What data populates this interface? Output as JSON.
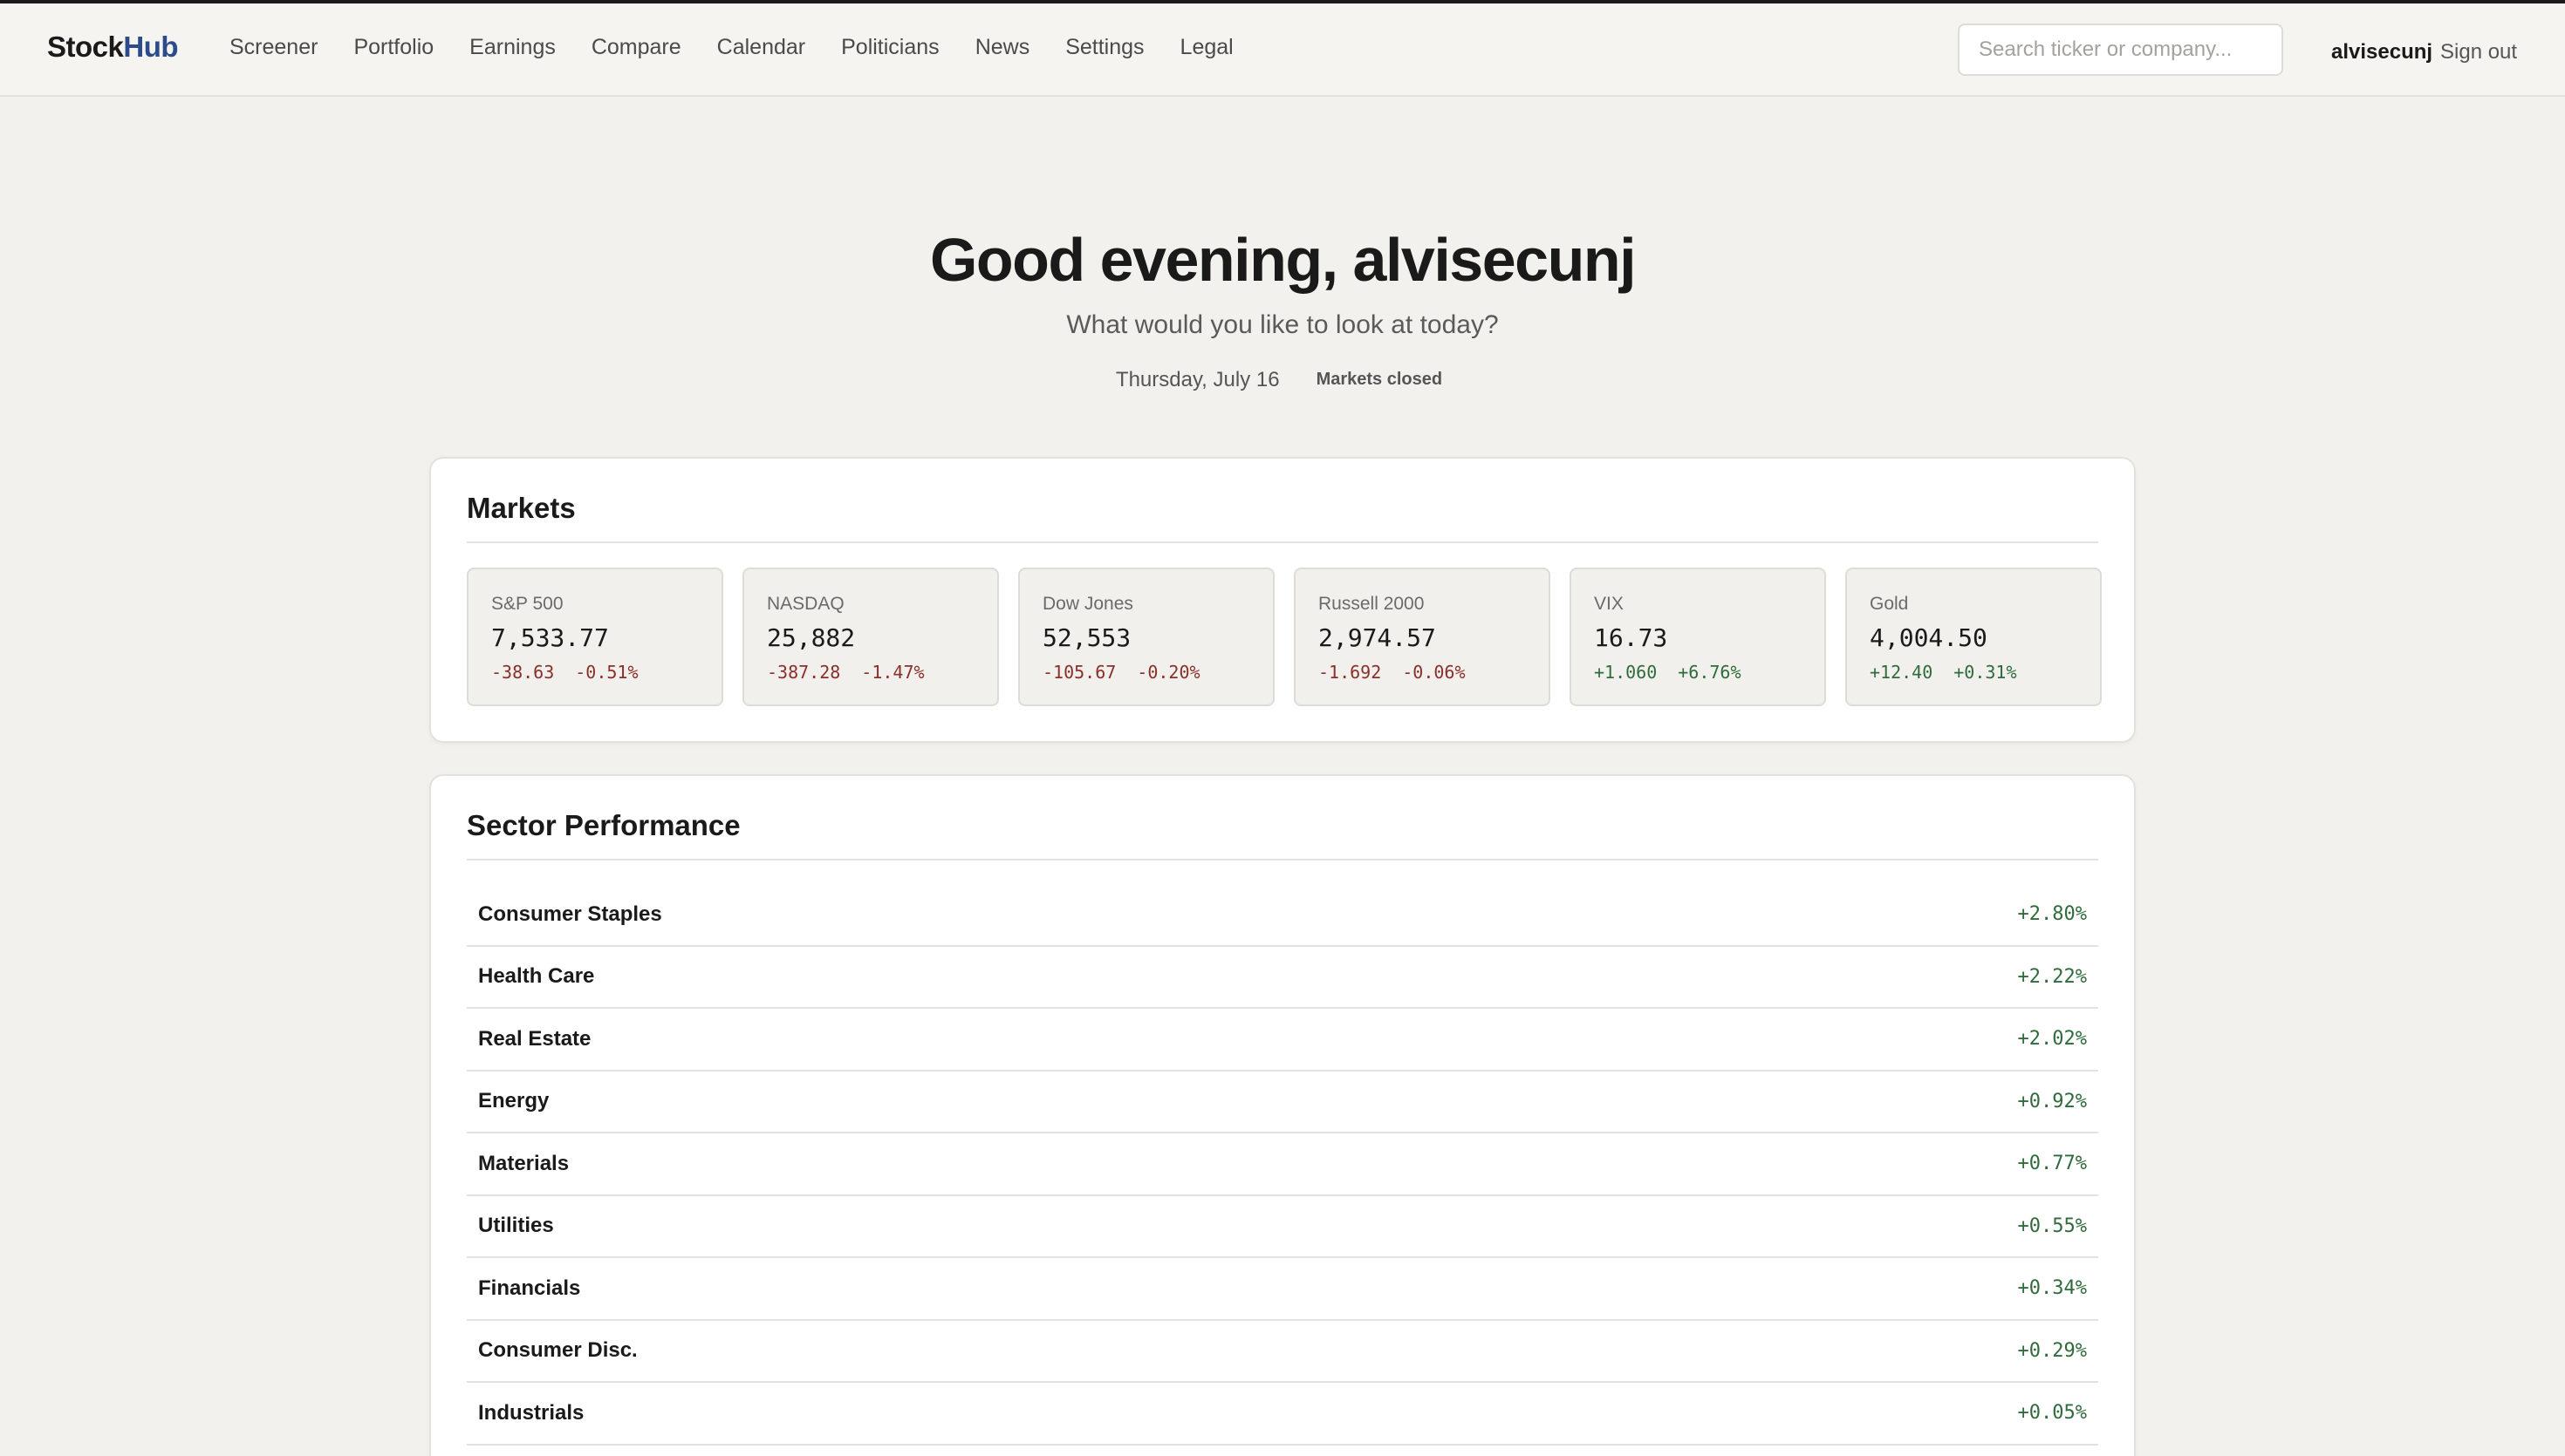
{
  "brand": {
    "name_part1": "Stock",
    "name_part2": "Hub",
    "accent_color": "#2d4a8a"
  },
  "nav": {
    "links": [
      "Screener",
      "Portfolio",
      "Earnings",
      "Compare",
      "Calendar",
      "Politicians",
      "News",
      "Settings",
      "Legal"
    ]
  },
  "search": {
    "placeholder": "Search ticker or company..."
  },
  "user": {
    "name": "alvisecunj",
    "signout_label": "Sign out"
  },
  "hero": {
    "greeting": "Good evening, alvisecunj",
    "subtitle": "What would you like to look at today?",
    "date": "Thursday, July 16",
    "market_status": "Markets closed"
  },
  "markets": {
    "title": "Markets",
    "tiles": [
      {
        "name": "S&P 500",
        "value": "7,533.77",
        "change": "-38.63",
        "pct": "-0.51%",
        "direction": "down"
      },
      {
        "name": "NASDAQ",
        "value": "25,882",
        "change": "-387.28",
        "pct": "-1.47%",
        "direction": "down"
      },
      {
        "name": "Dow Jones",
        "value": "52,553",
        "change": "-105.67",
        "pct": "-0.20%",
        "direction": "down"
      },
      {
        "name": "Russell 2000",
        "value": "2,974.57",
        "change": "-1.692",
        "pct": "-0.06%",
        "direction": "down"
      },
      {
        "name": "VIX",
        "value": "16.73",
        "change": "+1.060",
        "pct": "+6.76%",
        "direction": "up"
      },
      {
        "name": "Gold",
        "value": "4,004.50",
        "change": "+12.40",
        "pct": "+0.31%",
        "direction": "up"
      }
    ]
  },
  "sectors": {
    "title": "Sector Performance",
    "rows": [
      {
        "name": "Consumer Staples",
        "pct": "+2.80%"
      },
      {
        "name": "Health Care",
        "pct": "+2.22%"
      },
      {
        "name": "Real Estate",
        "pct": "+2.02%"
      },
      {
        "name": "Energy",
        "pct": "+0.92%"
      },
      {
        "name": "Materials",
        "pct": "+0.77%"
      },
      {
        "name": "Utilities",
        "pct": "+0.55%"
      },
      {
        "name": "Financials",
        "pct": "+0.34%"
      },
      {
        "name": "Consumer Disc.",
        "pct": "+0.29%"
      },
      {
        "name": "Industrials",
        "pct": "+0.05%"
      }
    ]
  },
  "colors": {
    "negative": "#8a2f2a",
    "positive": "#2f6b3c",
    "background": "#f2f1ed"
  }
}
